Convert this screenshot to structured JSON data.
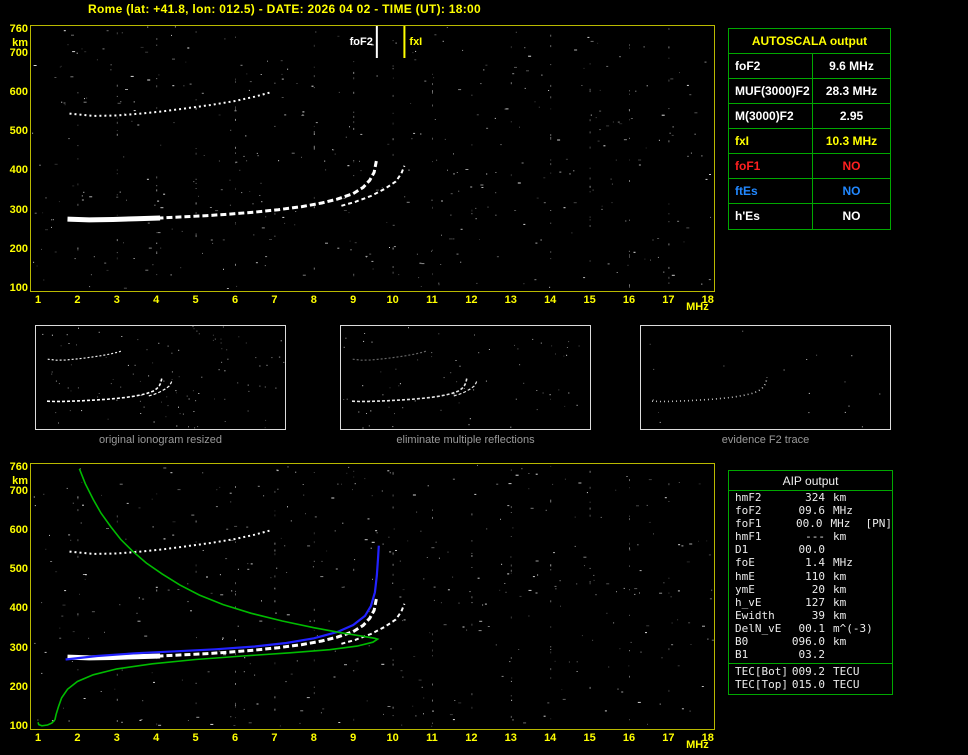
{
  "title": "Rome (lat: +41.8, lon: 012.5) - DATE: 2026 04 02 - TIME (UT): 18:00",
  "colors": {
    "accent_yellow": "#ffff00",
    "plot_border_yellow": "#b9b900",
    "table_border_green": "#00a800",
    "trace_white": "#ffffff",
    "profile_green": "#00bb00",
    "fitted_blue": "#2222ff",
    "no_red": "#ff2020",
    "es_blue": "#2288ff",
    "caption_gray": "#9a9a9a"
  },
  "axes": {
    "x_ticks": [
      1,
      2,
      3,
      4,
      5,
      6,
      7,
      8,
      9,
      10,
      11,
      12,
      13,
      14,
      15,
      16,
      17,
      18
    ],
    "x_unit": "MHz",
    "y_ticks": [
      760,
      700,
      600,
      500,
      400,
      300,
      200,
      100
    ],
    "y_unit": "km",
    "x_range": [
      1,
      18
    ],
    "y_range": [
      100,
      760
    ]
  },
  "top_ionogram": {
    "markers": [
      {
        "label": "foF2",
        "freq": 9.6,
        "color": "#ffffff",
        "side": "left"
      },
      {
        "label": "fxI",
        "freq": 10.3,
        "color": "#ffff00",
        "side": "right"
      }
    ]
  },
  "autoscala_table": {
    "title": "AUTOSCALA output",
    "rows": [
      {
        "label": "foF2",
        "value": "9.6 MHz",
        "color": "#ffffff"
      },
      {
        "label": "MUF(3000)F2",
        "value": "28.3 MHz",
        "color": "#ffffff"
      },
      {
        "label": "M(3000)F2",
        "value": "2.95",
        "color": "#ffffff"
      },
      {
        "label": "fxI",
        "value": "10.3 MHz",
        "color": "#ffff00"
      },
      {
        "label": "foF1",
        "value": "NO",
        "color": "#ff2020"
      },
      {
        "label": "ftEs",
        "value": "NO",
        "color": "#2288ff"
      },
      {
        "label": "h'Es",
        "value": "NO",
        "color": "#ffffff"
      }
    ]
  },
  "panels": [
    {
      "caption": "original ionogram resized"
    },
    {
      "caption": "eliminate multiple reflections"
    },
    {
      "caption": "evidence F2 trace"
    }
  ],
  "aip_table": {
    "title": "AIP output",
    "rows": [
      {
        "label": "hmF2",
        "value": "324",
        "unit": "km",
        "note": ""
      },
      {
        "label": "foF2",
        "value": "09.6",
        "unit": "MHz",
        "note": ""
      },
      {
        "label": "foF1",
        "value": "00.0",
        "unit": "MHz",
        "note": "[PN]"
      },
      {
        "label": "hmF1",
        "value": "---",
        "unit": "km",
        "note": ""
      },
      {
        "label": "D1",
        "value": "00.0",
        "unit": "",
        "note": ""
      },
      {
        "label": "foE",
        "value": "1.4",
        "unit": "MHz",
        "note": ""
      },
      {
        "label": "hmE",
        "value": "110",
        "unit": "km",
        "note": ""
      },
      {
        "label": "ymE",
        "value": "20",
        "unit": "km",
        "note": ""
      },
      {
        "label": "h_vE",
        "value": "127",
        "unit": "km",
        "note": ""
      },
      {
        "label": "Ewidth",
        "value": "39",
        "unit": "km",
        "note": ""
      },
      {
        "label": "DelN_vE",
        "value": "00.1",
        "unit": "m^(-3)",
        "note": ""
      },
      {
        "label": "B0",
        "value": "096.0",
        "unit": "km",
        "note": ""
      },
      {
        "label": "B1",
        "value": "03.2",
        "unit": "",
        "note": ""
      }
    ],
    "tec_rows": [
      {
        "label": "TEC[Bot]",
        "value": "009.2",
        "unit": "TECU"
      },
      {
        "label": "TEC[Top]",
        "value": "015.0",
        "unit": "TECU"
      }
    ]
  },
  "chart_data": [
    {
      "type": "scatter",
      "title": "ionogram (echo traces) with AUTOSCALA markers",
      "xlabel": "MHz",
      "ylabel": "km",
      "xlim": [
        1,
        18
      ],
      "ylim": [
        100,
        760
      ],
      "markers": [
        {
          "label": "foF2",
          "x": 9.6
        },
        {
          "label": "fxI",
          "x": 10.3
        }
      ],
      "series": [
        {
          "name": "F2 trace O-mode",
          "points": [
            [
              1.75,
              278
            ],
            [
              2.3,
              276
            ],
            [
              2.9,
              277
            ],
            [
              3.5,
              279
            ],
            [
              4.1,
              281
            ],
            [
              4.7,
              284
            ],
            [
              5.3,
              287
            ],
            [
              5.9,
              291
            ],
            [
              6.5,
              296
            ],
            [
              7.1,
              302
            ],
            [
              7.7,
              310
            ],
            [
              8.2,
              319
            ],
            [
              8.6,
              329
            ],
            [
              9.0,
              343
            ],
            [
              9.25,
              359
            ],
            [
              9.42,
              377
            ],
            [
              9.53,
              397
            ],
            [
              9.6,
              432
            ]
          ]
        },
        {
          "name": "F2 trace X-mode",
          "points": [
            [
              8.7,
              312
            ],
            [
              9.05,
              322
            ],
            [
              9.45,
              337
            ],
            [
              9.8,
              355
            ],
            [
              10.08,
              374
            ],
            [
              10.22,
              394
            ],
            [
              10.3,
              414
            ]
          ]
        },
        {
          "name": "second reflection (multiple)",
          "points": [
            [
              1.8,
              547
            ],
            [
              2.4,
              541
            ],
            [
              3.0,
              542
            ],
            [
              3.6,
              547
            ],
            [
              4.2,
              553
            ],
            [
              4.8,
              561
            ],
            [
              5.4,
              569
            ],
            [
              6.0,
              579
            ],
            [
              6.5,
              590
            ],
            [
              6.9,
              601
            ]
          ]
        }
      ]
    },
    {
      "type": "line",
      "title": "ionogram with restored electron density profile and fitted trace",
      "xlabel": "MHz",
      "ylabel": "km",
      "xlim": [
        1,
        18
      ],
      "ylim": [
        100,
        760
      ],
      "series": [
        {
          "name": "electron density profile (F region)",
          "color": "#00bb00",
          "points": [
            [
              2.05,
              758
            ],
            [
              2.2,
              720
            ],
            [
              2.4,
              680
            ],
            [
              2.6,
              645
            ],
            [
              2.85,
              610
            ],
            [
              3.1,
              578
            ],
            [
              3.4,
              548
            ],
            [
              3.75,
              518
            ],
            [
              4.15,
              490
            ],
            [
              4.6,
              462
            ],
            [
              5.1,
              436
            ],
            [
              5.7,
              412
            ],
            [
              6.4,
              390
            ],
            [
              7.2,
              370
            ],
            [
              8.0,
              353
            ],
            [
              8.7,
              340
            ],
            [
              9.25,
              331
            ],
            [
              9.55,
              326
            ],
            [
              9.62,
              324
            ],
            [
              9.5,
              316
            ],
            [
              9.1,
              306
            ],
            [
              8.4,
              297
            ],
            [
              7.4,
              289
            ],
            [
              6.2,
              281
            ],
            [
              5.0,
              272
            ],
            [
              3.9,
              261
            ],
            [
              3.0,
              248
            ],
            [
              2.4,
              233
            ],
            [
              2.0,
              216
            ],
            [
              1.75,
              196
            ],
            [
              1.6,
              174
            ],
            [
              1.52,
              152
            ],
            [
              1.46,
              132
            ],
            [
              1.43,
              118
            ]
          ]
        },
        {
          "name": "electron density profile (E region)",
          "color": "#00bb00",
          "points": [
            [
              1.43,
              118
            ],
            [
              1.35,
              110
            ],
            [
              1.24,
              105
            ],
            [
              1.1,
              103
            ],
            [
              1.02,
              106
            ],
            [
              1.0,
              112
            ]
          ]
        },
        {
          "name": "fitted F2 trace",
          "color": "#2222ff",
          "points": [
            [
              1.7,
              272
            ],
            [
              2.5,
              281
            ],
            [
              3.5,
              288
            ],
            [
              4.5,
              293
            ],
            [
              5.5,
              298
            ],
            [
              6.5,
              305
            ],
            [
              7.3,
              314
            ],
            [
              8.0,
              326
            ],
            [
              8.6,
              342
            ],
            [
              9.0,
              360
            ],
            [
              9.3,
              383
            ],
            [
              9.45,
              408
            ],
            [
              9.55,
              443
            ],
            [
              9.6,
              485
            ],
            [
              9.63,
              528
            ],
            [
              9.65,
              562
            ]
          ]
        }
      ]
    }
  ]
}
